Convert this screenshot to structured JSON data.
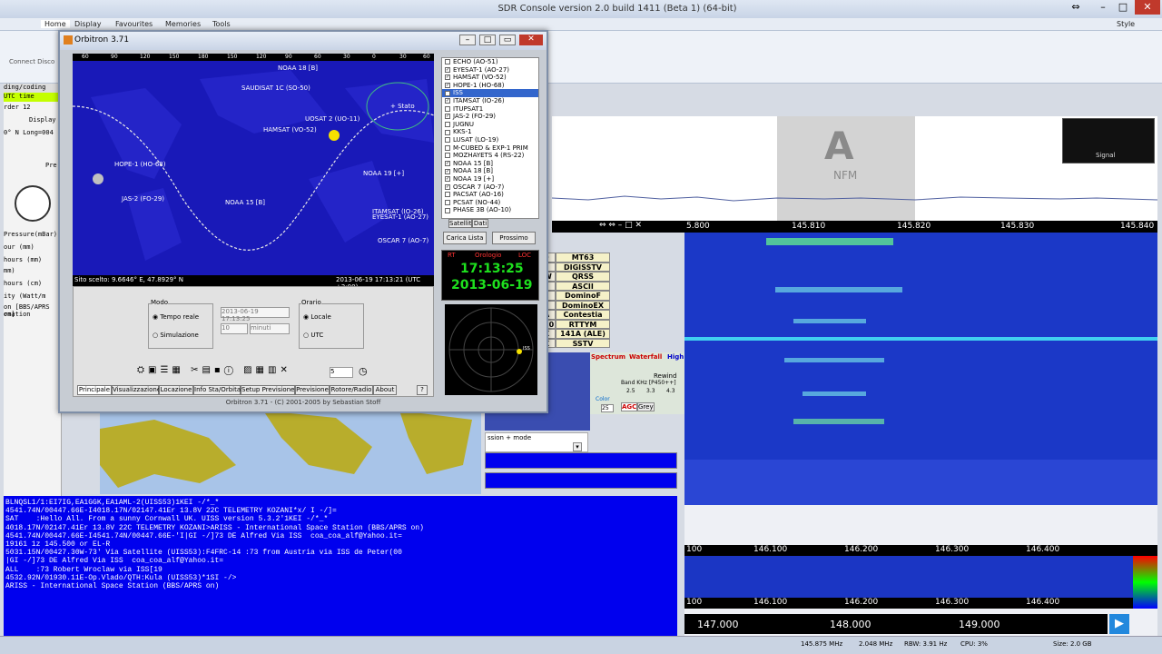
{
  "sdr": {
    "title": "SDR Console version 2.0 build 1411 (Beta 1) (64-bit)",
    "tabs": [
      "Home",
      "Display",
      "Favourites",
      "Memories",
      "Tools"
    ],
    "ribbon_item": "Connect  Disco",
    "style_label": "Style",
    "spectrum_mode_letter": "A",
    "spectrum_mode": "NFM",
    "signal_label": "Signal",
    "freq_ticks": [
      "5.800",
      "145.810",
      "145.820",
      "145.830",
      "145.840"
    ],
    "low_ticks_1": [
      "100",
      "146.100",
      "146.200",
      "146.300",
      "146.400"
    ],
    "low_ticks_2": [
      "100",
      "146.100",
      "146.200",
      "146.300",
      "146.400"
    ],
    "low_ticks_3": [
      "147.000",
      "148.000",
      "149.000"
    ],
    "status": [
      "145.875 MHz",
      "2.048 MHz",
      "RBW: 3.91 Hz",
      "CPU: 3%",
      "Size: 2.0 GB"
    ]
  },
  "left": {
    "rows": [
      "ding/coding",
      "UTC time",
      "rder  12",
      "Display",
      "0° N Long=004",
      "Pre",
      "Pressure(mBar)",
      "our (mm)",
      "hours (mm)",
      "mm)",
      "hours (cm)",
      "ity (Watt/m",
      "on [BBS/APRS on]",
      "rmation"
    ]
  },
  "modes": [
    [
      "0",
      "MT63"
    ],
    [
      "F",
      "DIGISSTV"
    ],
    [
      "W",
      "QRSS"
    ],
    [
      "2",
      "ASCII"
    ],
    [
      "1",
      "DominoF"
    ],
    [
      "1",
      "DominoEX"
    ],
    [
      "A",
      "Contestia"
    ],
    [
      "30",
      "RTTYM"
    ],
    [
      "X",
      "141A (ALE)"
    ],
    [
      "X",
      "SSTV"
    ]
  ],
  "scope_tabs": [
    "Spectrum",
    "Waterfall",
    "High"
  ],
  "scope": {
    "rewind": "Rewind",
    "band_khz": "Band KHz [P450++]",
    "band_opts": [
      "2.5",
      "3.3",
      "4.3"
    ],
    "color": "Color",
    "color_val": "25",
    "agc": "AGC",
    "grey": "Grey",
    "mode_select": "ssion + mode"
  },
  "console_lines": [
    "BLNQSL1/1:EI7IG,EA1GGK,EA1AML-2(UISS53)1KEI -/*_*",
    "4541.74N/00447.66E-I4018.17N/02147.41Er 13.8V 22C TELEMETRY KOZANI*x/ I -/]=",
    "SAT    :Hello All. From a sunny Cornwall UK. UISS version 5.3.2'1KEI -/*_*",
    "4018.17N/02147.41Er 13.8V 22C TELEMETRY KOZANI>ARISS - International Space Station (BBS/APRS on)",
    "4541.74N/00447.66E-I4541.74N/00447.66E-'I|GI -/]73 DE Alfred Via ISS  coa_coa_alf@Yahoo.it=",
    "19161 1z 145.500 or EL-R",
    "5031.15N/00427.30W-73' Via Satellite (UISS53):F4FRC-14 :73 from Austria via ISS de Peter(00",
    "|GI -/]73 DE Alfred Via ISS  coa_coa_alf@Yahoo.it=",
    "ALL    :73 Robert Wroclaw via ISS[19",
    "4532.92N/01930.11E-Op.Vlado/QTH:Kula (UISS53)*1SI -/>",
    "ARISS - International Space Station (BBS/APRS on)"
  ],
  "orbitron": {
    "title": "Orbitron 3.71",
    "top_ticks": [
      "60",
      "90",
      "120",
      "150",
      "180",
      "150",
      "120",
      "90",
      "60",
      "30",
      "0",
      "30",
      "60"
    ],
    "side_ticks": [
      "90",
      "60",
      "30",
      "0",
      "30",
      "60"
    ],
    "satellites": [
      {
        "name": "NOAA 18 [B]"
      },
      {
        "name": "SAUDISAT 1C (SO-50)"
      },
      {
        "name": "UOSAT 2 (UO-11)"
      },
      {
        "name": "HAMSAT (VO-52)"
      },
      {
        "name": "HOPE-1 (HO-68)"
      },
      {
        "name": "NOAA 19 [+]"
      },
      {
        "name": "JAS-2 (FO-29)"
      },
      {
        "name": "NOAA 15 [B]"
      },
      {
        "name": "ITAMSAT (IO-26)"
      },
      {
        "name": "EYESAT-1 (AO-27)"
      },
      {
        "name": "OSCAR 7 (AO-7)"
      },
      {
        "name": "+ Stato"
      }
    ],
    "site": "Sito scelto: 9.6646° E, 47.8929° N",
    "datetime": "2013-06-19 17:13:21 (UTC +2:00)",
    "mode_group": "Modo",
    "mode_real": "Tempo reale",
    "mode_sim": "Simulazione",
    "sim_date": "2013-06-19 17:13:25",
    "step_val": "10",
    "step_unit": "minuti",
    "time_group": "Orario",
    "time_local": "Locale",
    "time_utc": "UTC",
    "toolbar_num": "5",
    "tabs": [
      "Principale",
      "Visualizzazione",
      "Locazione",
      "Info Sta/Orbita",
      "Setup Previsione",
      "Previsione",
      "Rotore/Radio",
      "About",
      "?"
    ],
    "sat_list": [
      {
        "name": "ECHO (AO-51)",
        "on": false
      },
      {
        "name": "EYESAT-1 (AO-27)",
        "on": true
      },
      {
        "name": "HAMSAT (VO-52)",
        "on": true
      },
      {
        "name": "HOPE-1 (HO-68)",
        "on": true
      },
      {
        "name": "ISS",
        "on": true,
        "sel": true
      },
      {
        "name": "ITAMSAT (IO-26)",
        "on": true
      },
      {
        "name": "ITUPSAT1",
        "on": false
      },
      {
        "name": "JAS-2 (FO-29)",
        "on": true
      },
      {
        "name": "JUGNU",
        "on": false
      },
      {
        "name": "KKS-1",
        "on": false
      },
      {
        "name": "LUSAT (LO-19)",
        "on": false
      },
      {
        "name": "M-CUBED & EXP-1 PRIM",
        "on": false
      },
      {
        "name": "MOZHAYETS 4 (RS-22)",
        "on": false
      },
      {
        "name": "NOAA 15 [B]",
        "on": true
      },
      {
        "name": "NOAA 18 [B]",
        "on": true
      },
      {
        "name": "NOAA 19 [+]",
        "on": true
      },
      {
        "name": "OSCAR 7 (AO-7)",
        "on": true
      },
      {
        "name": "PACSAT (AO-16)",
        "on": false
      },
      {
        "name": "PCSAT (NO-44)",
        "on": false
      },
      {
        "name": "PHASE 3B (AO-10)",
        "on": false
      }
    ],
    "list_tabs": [
      "Satelliti",
      "Dati"
    ],
    "btn_load": "Carica Lista",
    "btn_next": "Prossimo",
    "clock_tabs": [
      "RT",
      "Orologio",
      "LOC"
    ],
    "clock_time": "17:13:25",
    "clock_date": "2013-06-19",
    "radar_label": "ISS",
    "footer": "Orbitron 3.71 - (C) 2001-2005 by Sebastian Stoff"
  }
}
